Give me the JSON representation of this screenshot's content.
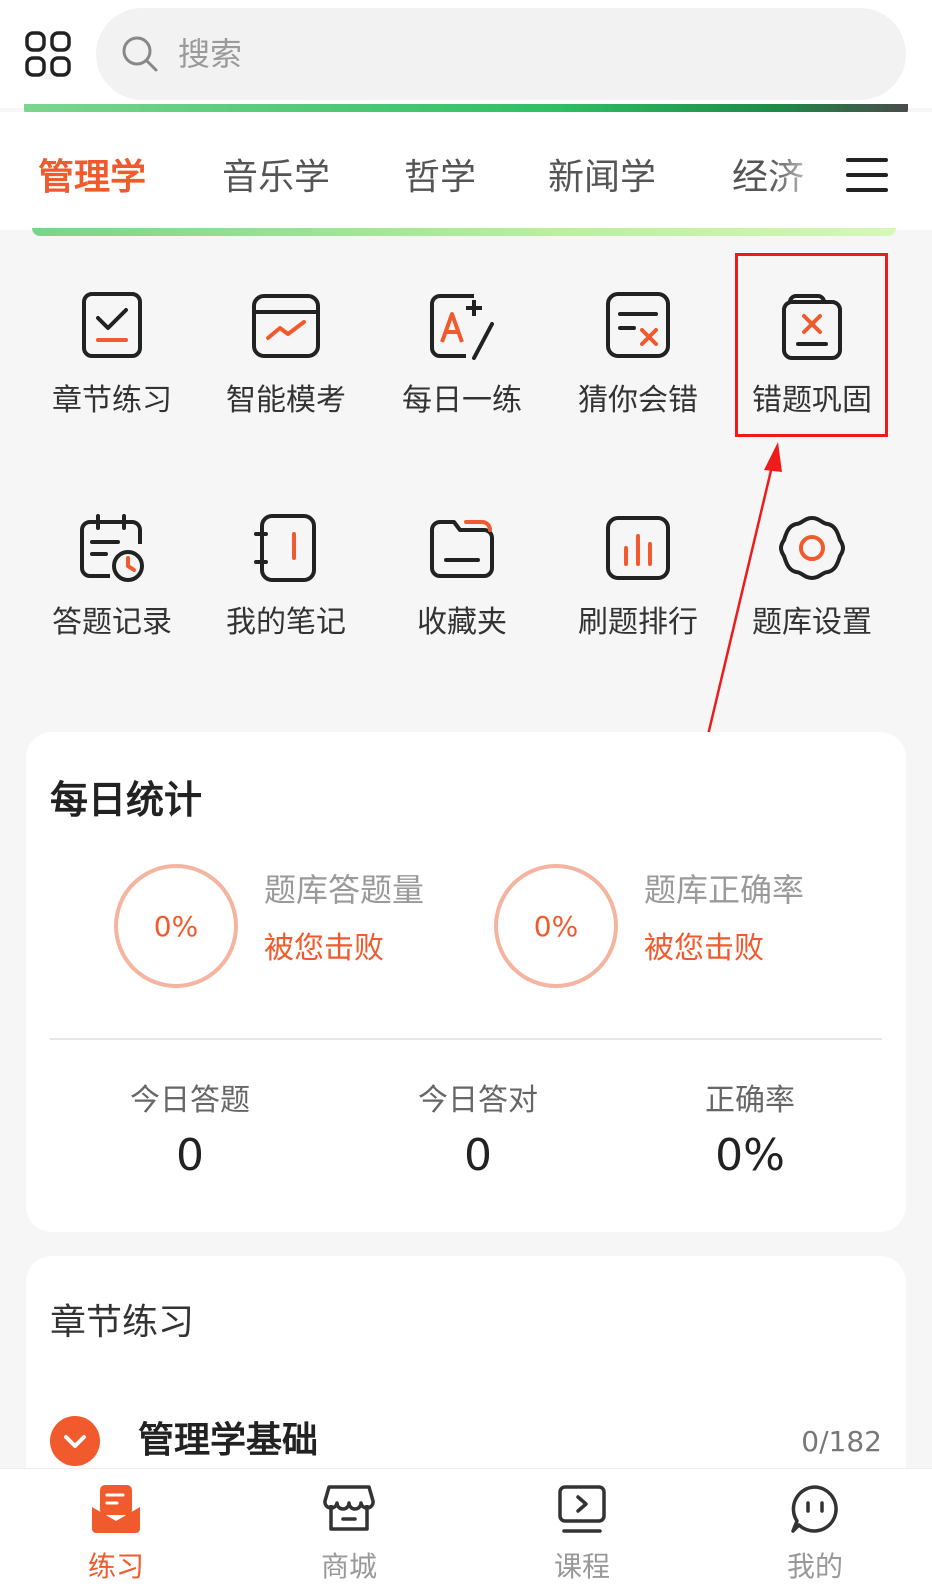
{
  "search": {
    "placeholder": "搜索"
  },
  "tabs": [
    {
      "label": "管理学",
      "active": true
    },
    {
      "label": "音乐学"
    },
    {
      "label": "哲学"
    },
    {
      "label": "新闻学"
    },
    {
      "label": "经济"
    }
  ],
  "features": [
    {
      "label": "章节练习",
      "icon": "checklist-icon"
    },
    {
      "label": "智能模考",
      "icon": "trend-window-icon"
    },
    {
      "label": "每日一练",
      "icon": "a-plus-pen-icon"
    },
    {
      "label": "猜你会错",
      "icon": "doc-x-icon"
    },
    {
      "label": "错题巩固",
      "icon": "stacked-doc-x-icon"
    },
    {
      "label": "答题记录",
      "icon": "calendar-clock-icon"
    },
    {
      "label": "我的笔记",
      "icon": "notebook-icon"
    },
    {
      "label": "收藏夹",
      "icon": "folder-icon"
    },
    {
      "label": "刷题排行",
      "icon": "bar-chart-icon"
    },
    {
      "label": "题库设置",
      "icon": "gear-icon"
    }
  ],
  "stats": {
    "title": "每日统计",
    "ring1": {
      "value": "0%",
      "label": "题库答题量",
      "sub": "被您击败"
    },
    "ring2": {
      "value": "0%",
      "label": "题库正确率",
      "sub": "被您击败"
    },
    "metrics": [
      {
        "label": "今日答题",
        "value": "0"
      },
      {
        "label": "今日答对",
        "value": "0"
      },
      {
        "label": "正确率",
        "value": "0%"
      }
    ]
  },
  "chapter": {
    "title": "章节练习",
    "first": {
      "name": "管理学基础",
      "progress": "0/182"
    }
  },
  "nav": [
    {
      "label": "练习",
      "active": true
    },
    {
      "label": "商城"
    },
    {
      "label": "课程"
    },
    {
      "label": "我的"
    }
  ],
  "colors": {
    "accent": "#f05a2c",
    "annotation": "#ee1b1b"
  }
}
